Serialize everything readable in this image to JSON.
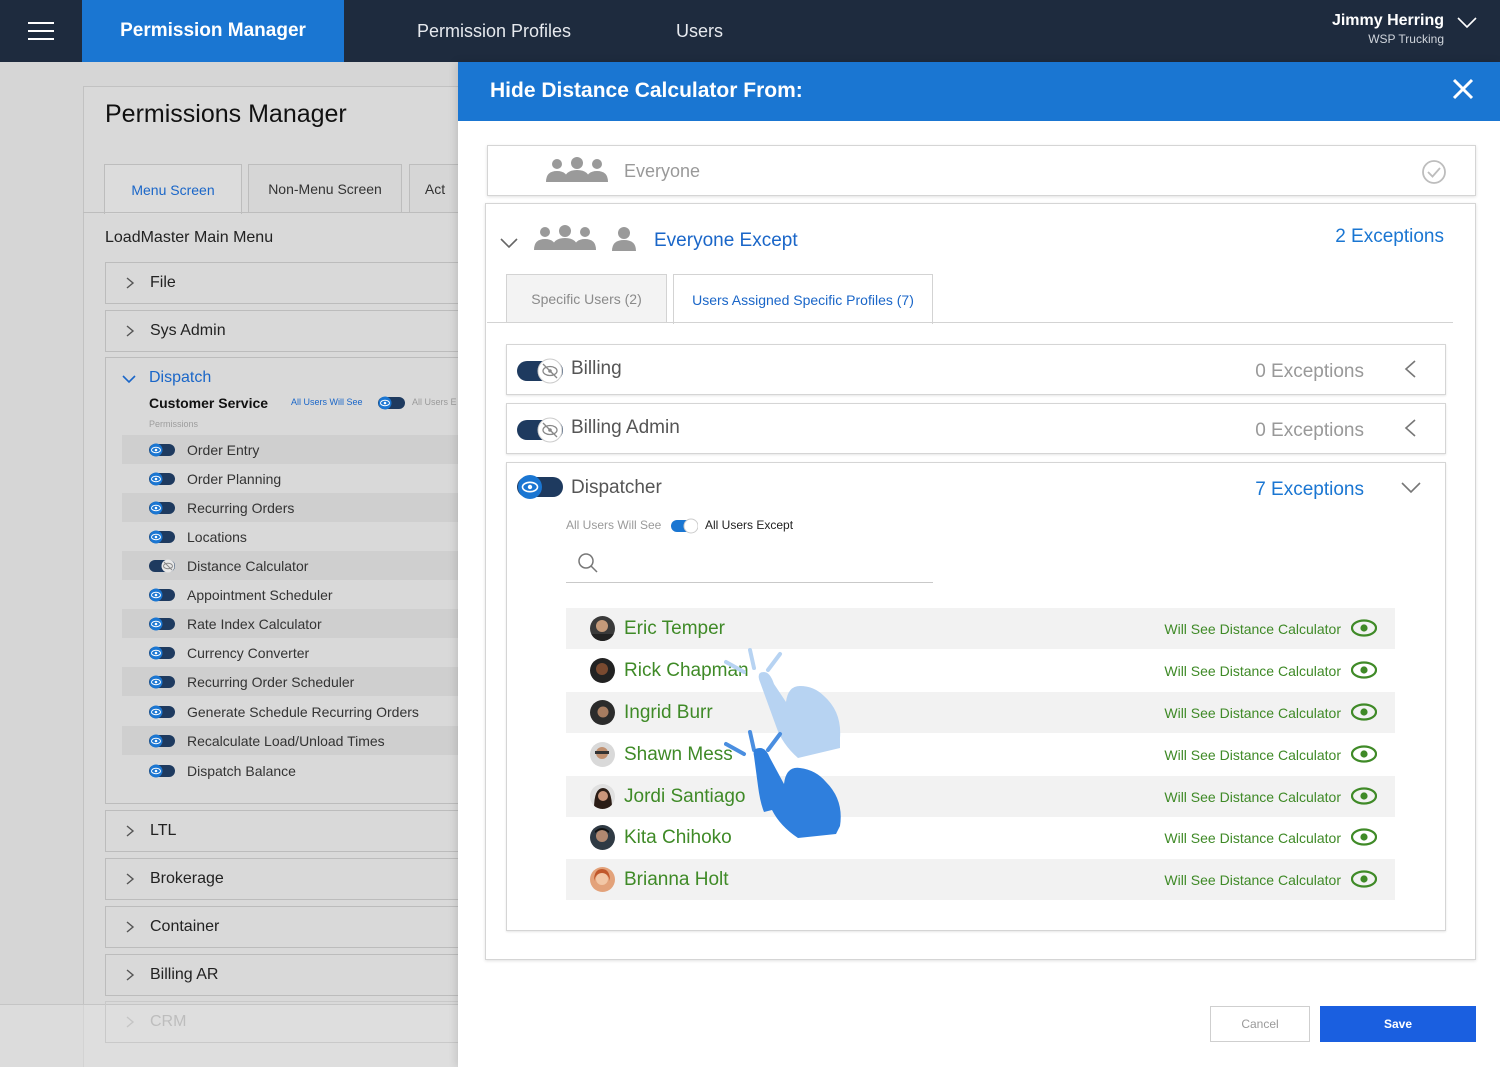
{
  "topbar": {
    "nav_active": "Permission Manager",
    "nav_profiles": "Permission Profiles",
    "nav_users": "Users",
    "user_name": "Jimmy Herring",
    "user_org": "WSP Trucking"
  },
  "bg": {
    "title": "Permissions Manager",
    "tabs": [
      "Menu Screen",
      "Non-Menu Screen",
      "Act"
    ],
    "menu_title": "LoadMaster Main Menu",
    "sections": [
      "File",
      "Sys Admin",
      "Dispatch",
      "LTL",
      "Brokerage",
      "Container",
      "Billing AR",
      "CRM"
    ],
    "customer_service": "Customer Service",
    "all_users_will_see": "All Users Will See",
    "all_users_except_cut": "All Users E",
    "permissions_label": "Permissions",
    "permissions": [
      "Order Entry",
      "Order Planning",
      "Recurring Orders",
      "Locations",
      "Distance Calculator",
      "Appointment Scheduler",
      "Rate Index Calculator",
      "Currency Converter",
      "Recurring Order Scheduler",
      "Generate Schedule Recurring Orders",
      "Recalculate Load/Unload Times",
      "Dispatch Balance"
    ]
  },
  "modal": {
    "title": "Hide Distance Calculator From:",
    "everyone": "Everyone",
    "everyone_except": "Everyone Except",
    "exceptions_total": "2 Exceptions",
    "tabs": [
      "Specific Users (2)",
      "Users Assigned Specific Profiles (7)"
    ],
    "profiles": [
      {
        "name": "Billing",
        "exceptions": "0 Exceptions"
      },
      {
        "name": "Billing Admin",
        "exceptions": "0 Exceptions"
      },
      {
        "name": "Dispatcher",
        "exceptions": "7 Exceptions"
      }
    ],
    "mini_toggle": {
      "left": "All Users Will See",
      "right": "All Users Except"
    },
    "will_see_text": "Will See Distance Calculator",
    "users": [
      "Eric Temper",
      "Rick Chapman",
      "Ingrid Burr",
      "Shawn Mess",
      "Jordi Santiago",
      "Kita Chihoko",
      "Brianna Holt"
    ],
    "cancel": "Cancel",
    "save": "Save"
  },
  "colors": {
    "topbar": "#1e2b3e",
    "accent": "#1a76d2",
    "green": "#3f8a27",
    "save": "#1a5fe0"
  }
}
